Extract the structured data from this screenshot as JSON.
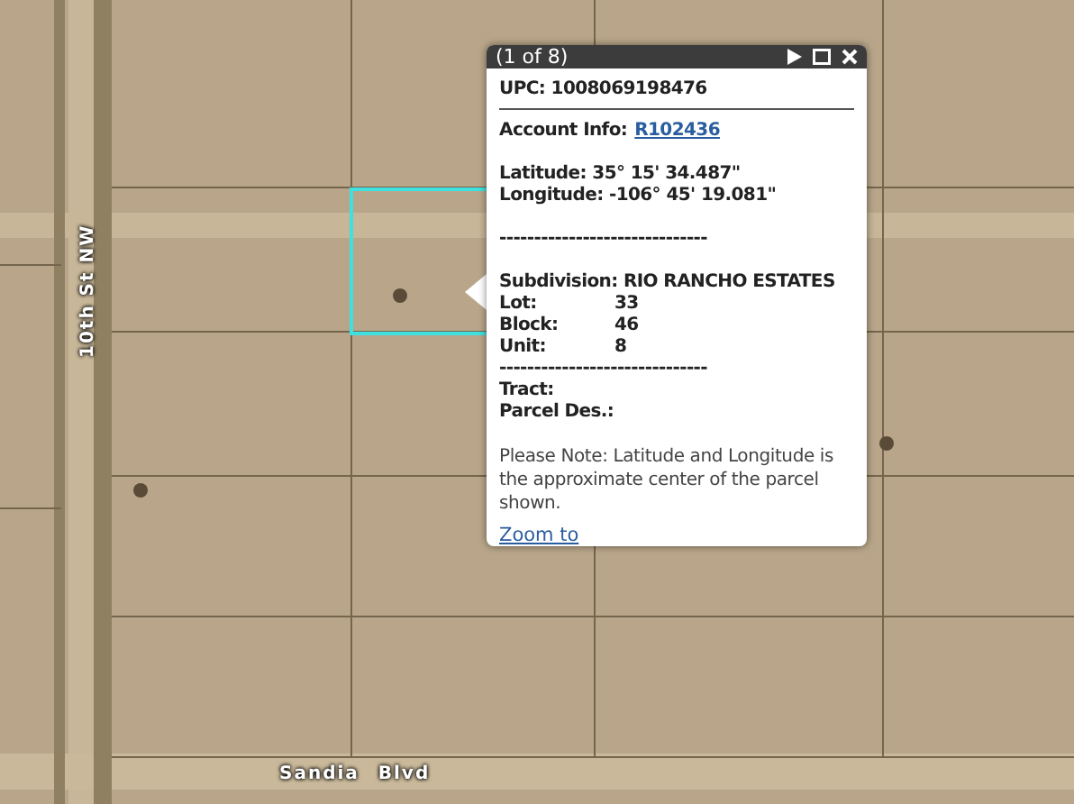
{
  "map": {
    "road_labels": [
      {
        "text": "10th St NW",
        "kind": "vertical"
      },
      {
        "text": "Sandia Blvd",
        "kind": "horizontal"
      }
    ]
  },
  "popup": {
    "title": "(1 of 8)",
    "upc": {
      "label": "UPC:",
      "value": "1008069198476"
    },
    "account": {
      "label": "Account Info:",
      "link": "R102436"
    },
    "latitude": {
      "label": "Latitude:",
      "value": "35° 15' 34.487\""
    },
    "longitude": {
      "label": "Longitude:",
      "value": "-106° 45' 19.081\""
    },
    "separator_1": "------------------------------",
    "subdivision": {
      "label": "Subdivision:",
      "value": "RIO RANCHO ESTATES"
    },
    "fields": [
      {
        "label": "Lot:",
        "value": "33"
      },
      {
        "label": "Block:",
        "value": "46"
      },
      {
        "label": "Unit:",
        "value": "8"
      }
    ],
    "separator_2": "------------------------------",
    "empty_fields": [
      {
        "label": "Tract:"
      },
      {
        "label": "Parcel Des.:"
      }
    ],
    "note": "Please Note: Latitude and Longitude is the approximate center of the parcel shown.",
    "footer_link": "Zoom to"
  }
}
